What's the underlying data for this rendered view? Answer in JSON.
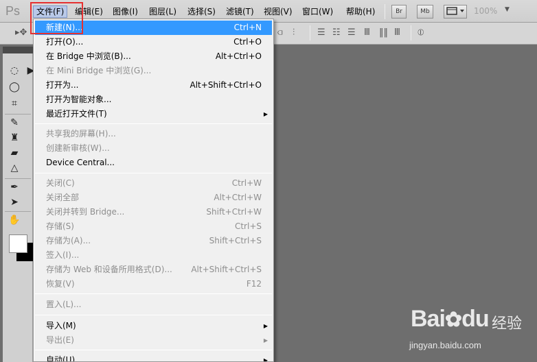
{
  "app": {
    "logo": "Ps"
  },
  "menubar": {
    "items": [
      "文件(F)",
      "编辑(E)",
      "图像(I)",
      "图层(L)",
      "选择(S)",
      "滤镜(T)",
      "视图(V)",
      "窗口(W)",
      "帮助(H)"
    ],
    "bridge_btn": "Br",
    "minibridge_btn": "Mb",
    "zoom": "100%",
    "zoom_arrow": "▼"
  },
  "file_menu": {
    "new": {
      "label": "新建(N)...",
      "shortcut": "Ctrl+N"
    },
    "open": {
      "label": "打开(O)...",
      "shortcut": "Ctrl+O"
    },
    "browse_bridge": {
      "label": "在 Bridge 中浏览(B)...",
      "shortcut": "Alt+Ctrl+O"
    },
    "browse_minibridge": {
      "label": "在 Mini Bridge 中浏览(G)...",
      "shortcut": ""
    },
    "open_as": {
      "label": "打开为...",
      "shortcut": "Alt+Shift+Ctrl+O"
    },
    "open_smart": {
      "label": "打开为智能对象...",
      "shortcut": ""
    },
    "recent": {
      "label": "最近打开文件(T)",
      "shortcut": ""
    },
    "share_screen": {
      "label": "共享我的屏幕(H)...",
      "shortcut": ""
    },
    "create_review": {
      "label": "创建新审核(W)...",
      "shortcut": ""
    },
    "device_central": {
      "label": "Device Central...",
      "shortcut": ""
    },
    "close": {
      "label": "关闭(C)",
      "shortcut": "Ctrl+W"
    },
    "close_all": {
      "label": "关闭全部",
      "shortcut": "Alt+Ctrl+W"
    },
    "close_goto_bridge": {
      "label": "关闭并转到 Bridge...",
      "shortcut": "Shift+Ctrl+W"
    },
    "save": {
      "label": "存储(S)",
      "shortcut": "Ctrl+S"
    },
    "save_as": {
      "label": "存储为(A)...",
      "shortcut": "Shift+Ctrl+S"
    },
    "check_in": {
      "label": "签入(I)...",
      "shortcut": ""
    },
    "save_web": {
      "label": "存储为 Web 和设备所用格式(D)...",
      "shortcut": "Alt+Shift+Ctrl+S"
    },
    "revert": {
      "label": "恢复(V)",
      "shortcut": "F12"
    },
    "place": {
      "label": "置入(L)...",
      "shortcut": ""
    },
    "import": {
      "label": "导入(M)",
      "shortcut": ""
    },
    "export": {
      "label": "导出(E)",
      "shortcut": ""
    },
    "automate": {
      "label": "自动(U)",
      "shortcut": ""
    }
  },
  "watermark": {
    "logo": "Bai",
    "logo_end": "du",
    "cn": "经验",
    "url": "jingyan.baidu.com"
  },
  "colors": {
    "selection": "#3399ff",
    "highlight_box": "#e53030",
    "canvas": "#6e6e6e"
  }
}
